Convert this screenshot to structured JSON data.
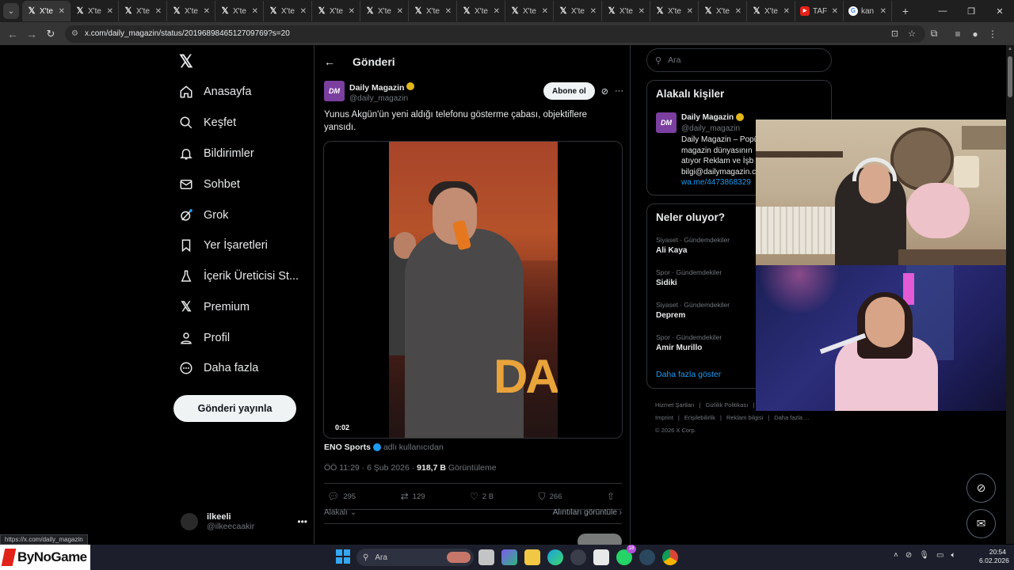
{
  "browser": {
    "tabs": [
      {
        "title": "X'te",
        "favicon": "x-logo-icon",
        "active": true
      },
      {
        "title": "X'te",
        "favicon": "x-logo-icon"
      },
      {
        "title": "X'te",
        "favicon": "x-logo-icon"
      },
      {
        "title": "X'te",
        "favicon": "x-logo-icon"
      },
      {
        "title": "X'te",
        "favicon": "x-logo-icon"
      },
      {
        "title": "X'te",
        "favicon": "x-logo-icon"
      },
      {
        "title": "X'te",
        "favicon": "x-logo-icon"
      },
      {
        "title": "X'te",
        "favicon": "x-logo-icon"
      },
      {
        "title": "X'te",
        "favicon": "x-logo-icon"
      },
      {
        "title": "X'te",
        "favicon": "x-logo-icon"
      },
      {
        "title": "X'te",
        "favicon": "x-logo-icon"
      },
      {
        "title": "X'te",
        "favicon": "x-logo-icon"
      },
      {
        "title": "X'te",
        "favicon": "x-logo-icon"
      },
      {
        "title": "X'te",
        "favicon": "x-logo-icon"
      },
      {
        "title": "X'te",
        "favicon": "x-logo-icon"
      },
      {
        "title": "X'te",
        "favicon": "x-logo-icon"
      },
      {
        "title": "TAF",
        "favicon": "youtube-icon"
      },
      {
        "title": "kan",
        "favicon": "google-icon"
      }
    ],
    "url": "x.com/daily_magazin/status/2019689846512709769?s=20",
    "status_url": "https://x.com/daily_magazin"
  },
  "nav": {
    "items": [
      {
        "label": "Anasayfa",
        "icon": "home-icon"
      },
      {
        "label": "Keşfet",
        "icon": "search-icon"
      },
      {
        "label": "Bildirimler",
        "icon": "bell-icon"
      },
      {
        "label": "Sohbet",
        "icon": "mail-icon"
      },
      {
        "label": "Grok",
        "icon": "grok-icon"
      },
      {
        "label": "Yer İşaretleri",
        "icon": "bookmark-icon"
      },
      {
        "label": "İçerik Üreticisi St...",
        "icon": "flask-icon"
      },
      {
        "label": "Premium",
        "icon": "x-logo-icon"
      },
      {
        "label": "Profil",
        "icon": "person-icon"
      },
      {
        "label": "Daha fazla",
        "icon": "more-circle-icon"
      }
    ],
    "post_button": "Gönderi yayınla",
    "account": {
      "name": "ilkeeli",
      "handle": "@ilkeecaakir"
    }
  },
  "post": {
    "header": "Gönderi",
    "author": {
      "name": "Daily Magazin",
      "handle": "@daily_magazin",
      "avatar": "DM"
    },
    "subscribe_label": "Abone ol",
    "text": "Yunus Akgün'ün yeni aldığı telefonu gösterme çabası, objektiflere yansıdı.",
    "video": {
      "duration": "0:02",
      "sign_text": "DAI"
    },
    "source": {
      "name": "ENO Sports",
      "via": "adlı kullanıcıdan"
    },
    "meta": {
      "time": "ÖÖ 11:29 · 6 Şub 2026 · ",
      "views": "918,7 B",
      "views_label": " Görüntüleme"
    },
    "stats": {
      "replies": "295",
      "reposts": "129",
      "likes": "2 B",
      "bookmarks": "266"
    },
    "related_label": "Alakalı",
    "quotes_label": "Alıntıları görüntüle"
  },
  "sidebar": {
    "search_placeholder": "Ara",
    "related_title": "Alakalı kişiler",
    "related_person": {
      "name": "Daily Magazin",
      "handle": "@daily_magazin",
      "bio_lines": [
        "Daily Magazin – Popü",
        "magazin dünyasının",
        "atıyor Reklam ve İşb",
        "bilgi@dailymagazin.c"
      ],
      "link": "wa.me/4473868329"
    },
    "trends_title": "Neler oluyor?",
    "trends": [
      {
        "category": "Siyaset · Gündemdekiler",
        "name": "Ali Kaya"
      },
      {
        "category": "Spor · Gündemdekiler",
        "name": "Sidiki"
      },
      {
        "category": "Siyaset · Gündemdekiler",
        "name": "Deprem"
      },
      {
        "category": "Spor · Gündemdekiler",
        "name": "Amir Murillo"
      }
    ],
    "show_more": "Daha fazla göster",
    "footer_links_1": [
      "Hizmet Şartları",
      "|",
      "Gizlilik Politikası",
      "|"
    ],
    "footer_links_2": [
      "Imprint",
      "|",
      "Erişilebilirlik",
      "|",
      "Reklam bilgisi",
      "|",
      "Daha fazla ..."
    ],
    "copyright": "© 2026 X Corp."
  },
  "taskbar": {
    "brand": "ByNoGame",
    "search_label": "Ara",
    "badge": "18",
    "time": "20:54",
    "date": "6.02.2026"
  }
}
